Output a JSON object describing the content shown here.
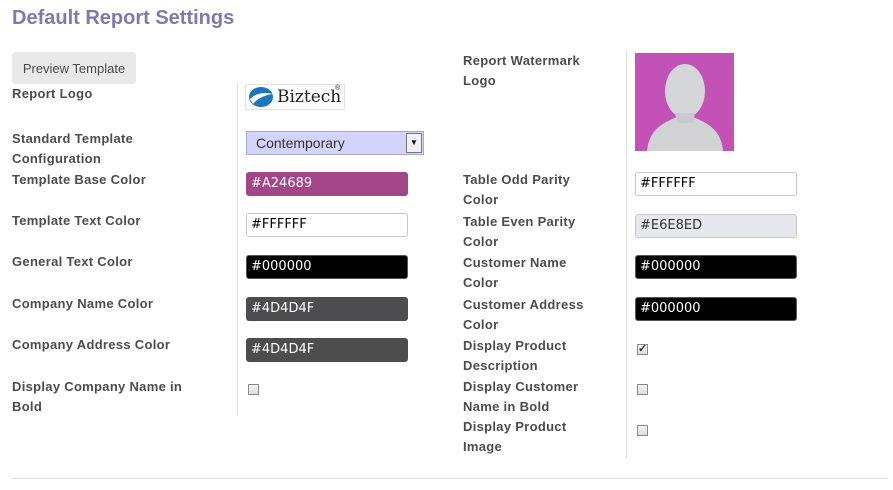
{
  "page": {
    "title": "Default Report Settings"
  },
  "preview_button": "Preview Template",
  "left": {
    "report_logo_label": "Report Logo",
    "logo_text": "Biztech",
    "logo_reg": "®",
    "template_label": "Standard Template Configuration",
    "template_value": "Contemporary",
    "base_color_label": "Template Base Color",
    "base_color": "#A24689",
    "text_color_label": "Template Text Color",
    "text_color": "#FFFFFF",
    "general_text_label": "General Text Color",
    "general_text": "#000000",
    "company_name_label": "Company Name Color",
    "company_name": "#4D4D4F",
    "company_address_label": "Company Address Color",
    "company_address": "#4D4D4F",
    "bold_company_label": "Display Company Name in Bold",
    "bold_company_checked": false
  },
  "right": {
    "watermark_label": "Report Watermark Logo",
    "odd_label": "Table Odd Parity Color",
    "odd_value": "#FFFFFF",
    "even_label": "Table Even Parity Color",
    "even_value": "#E6E8ED",
    "cust_name_label": "Customer Name Color",
    "cust_name_value": "#000000",
    "cust_addr_label": "Customer Address Color",
    "cust_addr_value": "#000000",
    "prod_desc_label": "Display Product Description",
    "prod_desc_checked": true,
    "cust_bold_label": "Display Customer Name in Bold",
    "cust_bold_checked": false,
    "prod_image_label": "Display Product Image",
    "prod_image_checked": false
  },
  "colors": {
    "title": "#7c7bad",
    "watermark_bg": "#c451b6",
    "logo_accent": "#1b78b5"
  }
}
